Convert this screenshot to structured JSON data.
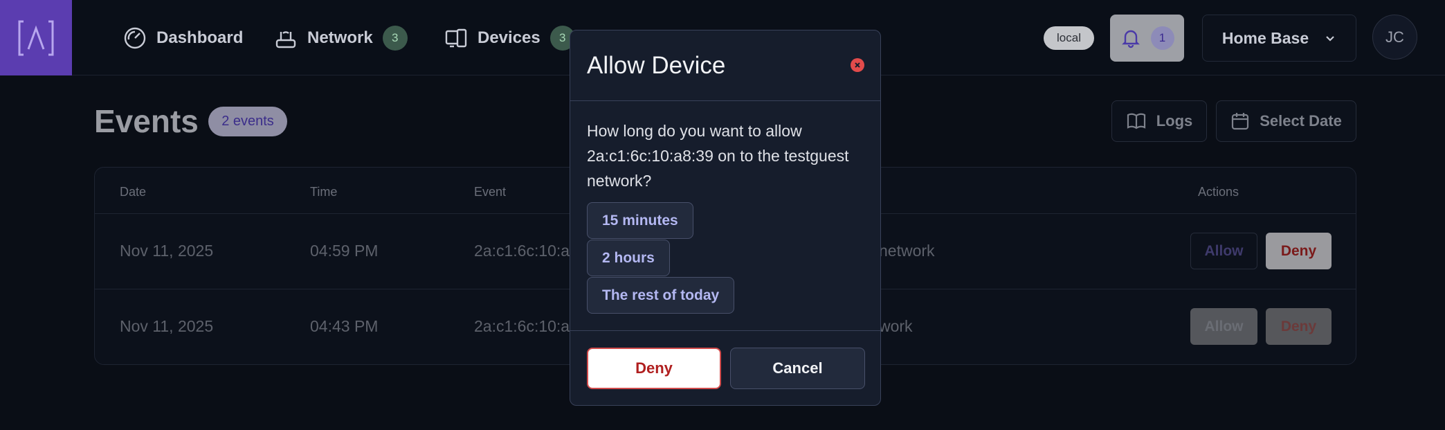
{
  "topbar": {
    "nav": [
      {
        "label": "Dashboard",
        "icon": "gauge-icon"
      },
      {
        "label": "Network",
        "icon": "router-icon",
        "badge": "3"
      },
      {
        "label": "Devices",
        "icon": "devices-icon",
        "badge": "3"
      }
    ],
    "env_badge": "local",
    "notifications": {
      "icon": "bell-icon",
      "count": "1"
    },
    "site_selector": "Home Base",
    "avatar_initials": "JC"
  },
  "page": {
    "title": "Events",
    "count_badge": "2 events",
    "logs_label": "Logs",
    "select_date_label": "Select Date"
  },
  "table": {
    "columns": [
      "Date",
      "Time",
      "Event",
      "Actions"
    ],
    "rows": [
      {
        "date": "Nov 11, 2025",
        "time": "04:59 PM",
        "event": "2a:c1:6c:10:a",
        "event_tail": "network",
        "allow": "Allow",
        "deny": "Deny"
      },
      {
        "date": "Nov 11, 2025",
        "time": "04:43 PM",
        "event": "2a:c1:6c:10:a",
        "event_tail": "work",
        "allow": "Allow",
        "deny": "Deny"
      }
    ]
  },
  "modal": {
    "title": "Allow Device",
    "question": "How long do you want to allow 2a:c1:6c:10:a8:39 on to the testguest network?",
    "options": [
      "15 minutes",
      "2 hours",
      "The rest of today"
    ],
    "deny_label": "Deny",
    "cancel_label": "Cancel"
  },
  "colors": {
    "brand": "#5b3db0",
    "modal_bg": "#161d2c",
    "option_text": "#b4b8f2",
    "deny_text": "#b01f1f"
  }
}
